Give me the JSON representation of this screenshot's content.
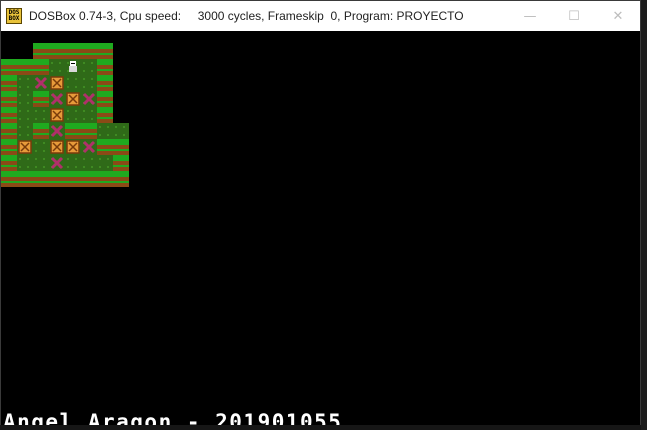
{
  "window": {
    "title": "DOSBox 0.74-3, Cpu speed:     3000 cycles, Frameskip  0, Program: PROYECTO",
    "icon_text_top": "DOS",
    "icon_text_bottom": "BOX",
    "controls": {
      "minimize_icon": "—",
      "maximize_icon": "☐",
      "close_icon": "✕"
    }
  },
  "game": {
    "credits": "Angel Aragon - 201901055",
    "colors": {
      "wall_green": "#1faa1f",
      "wall_dirt": "#8a4a16",
      "floor": "#2f6a18",
      "box": "#e79a3a",
      "goal": "#b0306a",
      "player": "#ffffff"
    }
  }
}
